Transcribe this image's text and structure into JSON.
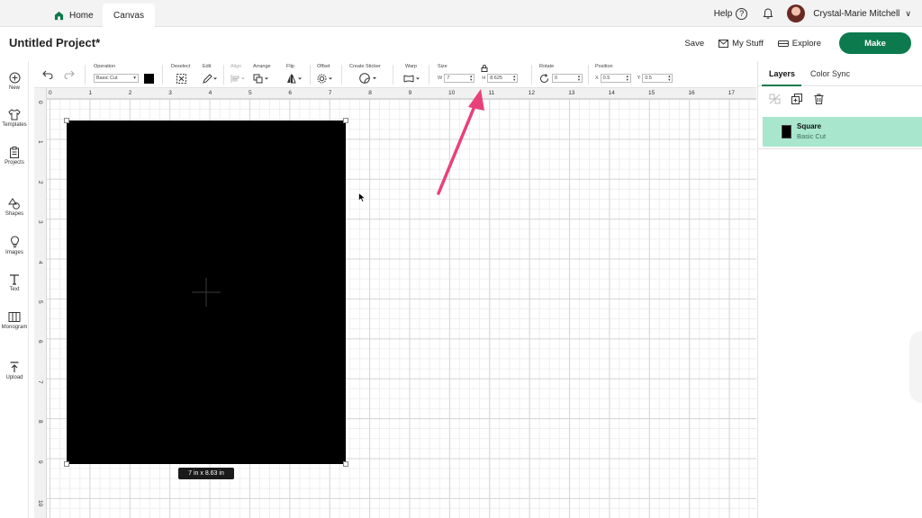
{
  "topbar": {
    "tabs": [
      {
        "label": "Home"
      },
      {
        "label": "Canvas"
      }
    ],
    "help_label": "Help",
    "help_glyph": "?",
    "user_name": "Crystal-Marie Mitchell"
  },
  "header": {
    "project_title": "Untitled Project*",
    "save_label": "Save",
    "my_stuff_label": "My Stuff",
    "explore_label": "Explore",
    "make_label": "Make"
  },
  "sidebar": {
    "items": [
      {
        "label": "New",
        "icon": "plus-circle-icon"
      },
      {
        "label": "Templates",
        "icon": "shirt-icon"
      },
      {
        "label": "Projects",
        "icon": "clipboard-icon"
      },
      {
        "label": "Shapes",
        "icon": "shapes-icon"
      },
      {
        "label": "Images",
        "icon": "lightbulb-icon"
      },
      {
        "label": "Text",
        "icon": "text-icon"
      },
      {
        "label": "Monogram",
        "icon": "monogram-icon"
      },
      {
        "label": "Upload",
        "icon": "upload-icon"
      }
    ]
  },
  "toolbar": {
    "operation_label": "Operation",
    "operation_value": "Basic Cut",
    "deselect_label": "Deselect",
    "edit_label": "Edit",
    "align_label": "Align",
    "arrange_label": "Arrange",
    "flip_label": "Flip",
    "offset_label": "Offset",
    "create_sticker_label": "Create Sticker",
    "warp_label": "Warp",
    "size_label": "Size",
    "w_label": "W",
    "w_value": "7",
    "h_label": "H",
    "h_value": "8.625",
    "rotate_label": "Rotate",
    "rotate_value": "0",
    "position_label": "Position",
    "x_label": "X",
    "x_value": "0.5",
    "y_label": "Y",
    "y_value": "0.5"
  },
  "ruler": {
    "top": [
      "0",
      "1",
      "2",
      "3",
      "4",
      "5",
      "6",
      "7",
      "8",
      "9",
      "10",
      "11",
      "12",
      "13",
      "14",
      "15",
      "16",
      "17"
    ],
    "left": [
      "0",
      "1",
      "2",
      "3",
      "4",
      "5",
      "6",
      "7",
      "8",
      "9",
      "10"
    ]
  },
  "canvas": {
    "size_badge": "7  in x 8.63  in",
    "shape_color": "#000000"
  },
  "right_panel": {
    "tabs": [
      {
        "label": "Layers"
      },
      {
        "label": "Color Sync"
      }
    ],
    "layers": [
      {
        "name": "Square",
        "operation": "Basic Cut"
      }
    ]
  },
  "colors": {
    "accent": "#0c7a4d",
    "layer_selected": "#a8e6ce",
    "annotation_arrow": "#e8407a"
  }
}
